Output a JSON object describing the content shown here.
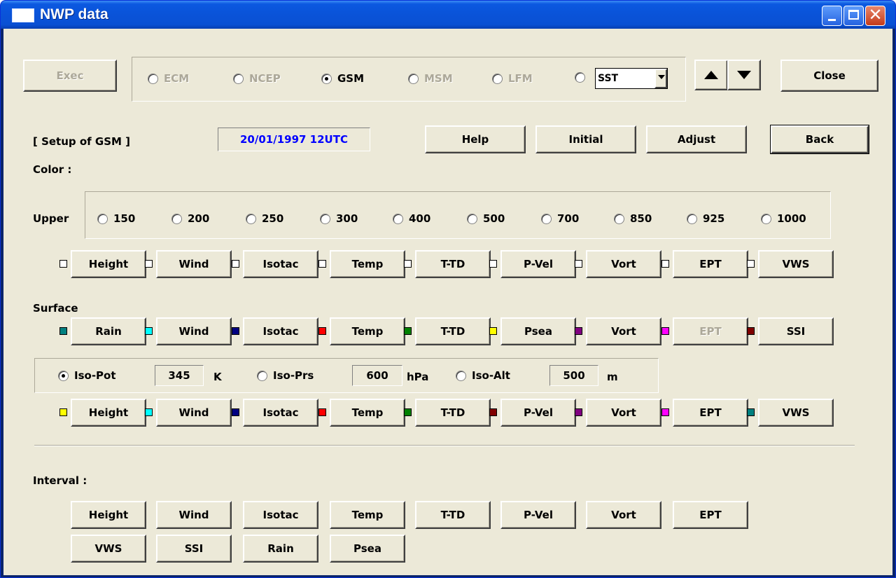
{
  "window": {
    "title": "NWP data"
  },
  "toolbar": {
    "exec_label": "Exec",
    "close_label": "Close",
    "models": [
      {
        "label": "ECM",
        "selected": false,
        "enabled": false
      },
      {
        "label": "NCEP",
        "selected": false,
        "enabled": false
      },
      {
        "label": "GSM",
        "selected": true,
        "enabled": true
      },
      {
        "label": "MSM",
        "selected": false,
        "enabled": false
      },
      {
        "label": "LFM",
        "selected": false,
        "enabled": false
      }
    ],
    "extra_model": {
      "selected": false,
      "value": "SST"
    },
    "up_icon": "arrow-up-icon",
    "down_icon": "arrow-down-icon"
  },
  "setup": {
    "title": "[ Setup of GSM ]",
    "datetime": "20/01/1997 12UTC",
    "datetime_color": "#0000ff",
    "buttons": {
      "help": "Help",
      "initial": "Initial",
      "adjust": "Adjust",
      "back": "Back"
    }
  },
  "color": {
    "label": "Color :",
    "upper": {
      "label": "Upper",
      "levels": [
        "150",
        "200",
        "250",
        "300",
        "400",
        "500",
        "700",
        "850",
        "925",
        "1000"
      ],
      "selected_level": null,
      "buttons": [
        {
          "label": "Height",
          "color": "#ffffff",
          "enabled": true
        },
        {
          "label": "Wind",
          "color": "#ffffff",
          "enabled": true
        },
        {
          "label": "Isotac",
          "color": "#ffffff",
          "enabled": true
        },
        {
          "label": "Temp",
          "color": "#ffffff",
          "enabled": true
        },
        {
          "label": "T-TD",
          "color": "#ffffff",
          "enabled": true
        },
        {
          "label": "P-Vel",
          "color": "#ffffff",
          "enabled": true
        },
        {
          "label": "Vort",
          "color": "#ffffff",
          "enabled": true
        },
        {
          "label": "EPT",
          "color": "#ffffff",
          "enabled": true
        },
        {
          "label": "VWS",
          "color": "#ffffff",
          "enabled": true
        }
      ]
    },
    "surface": {
      "label": "Surface",
      "buttons": [
        {
          "label": "Rain",
          "color": "#008080",
          "enabled": true
        },
        {
          "label": "Wind",
          "color": "#00ffff",
          "enabled": true
        },
        {
          "label": "Isotac",
          "color": "#000080",
          "enabled": true
        },
        {
          "label": "Temp",
          "color": "#ff0000",
          "enabled": true
        },
        {
          "label": "T-TD",
          "color": "#008000",
          "enabled": true
        },
        {
          "label": "Psea",
          "color": "#ffff00",
          "enabled": true
        },
        {
          "label": "Vort",
          "color": "#800080",
          "enabled": true
        },
        {
          "label": "EPT",
          "color": "#ff00ff",
          "enabled": false
        },
        {
          "label": "SSI",
          "color": "#800000",
          "enabled": true
        }
      ]
    },
    "iso": {
      "options": [
        {
          "label": "Iso-Pot",
          "value": "345",
          "unit": "K",
          "selected": true
        },
        {
          "label": "Iso-Prs",
          "value": "600",
          "unit": "hPa",
          "selected": false
        },
        {
          "label": "Iso-Alt",
          "value": "500",
          "unit": "m",
          "selected": false
        }
      ],
      "buttons": [
        {
          "label": "Height",
          "color": "#ffff00",
          "enabled": true
        },
        {
          "label": "Wind",
          "color": "#00ffff",
          "enabled": true
        },
        {
          "label": "Isotac",
          "color": "#000080",
          "enabled": true
        },
        {
          "label": "Temp",
          "color": "#ff0000",
          "enabled": true
        },
        {
          "label": "T-TD",
          "color": "#008000",
          "enabled": true
        },
        {
          "label": "P-Vel",
          "color": "#800000",
          "enabled": true
        },
        {
          "label": "Vort",
          "color": "#800080",
          "enabled": true
        },
        {
          "label": "EPT",
          "color": "#ff00ff",
          "enabled": true
        },
        {
          "label": "VWS",
          "color": "#008080",
          "enabled": true
        }
      ]
    }
  },
  "interval": {
    "label": "Interval :",
    "row1": [
      "Height",
      "Wind",
      "Isotac",
      "Temp",
      "T-TD",
      "P-Vel",
      "Vort",
      "EPT"
    ],
    "row2": [
      "VWS",
      "SSI",
      "Rain",
      "Psea"
    ]
  }
}
